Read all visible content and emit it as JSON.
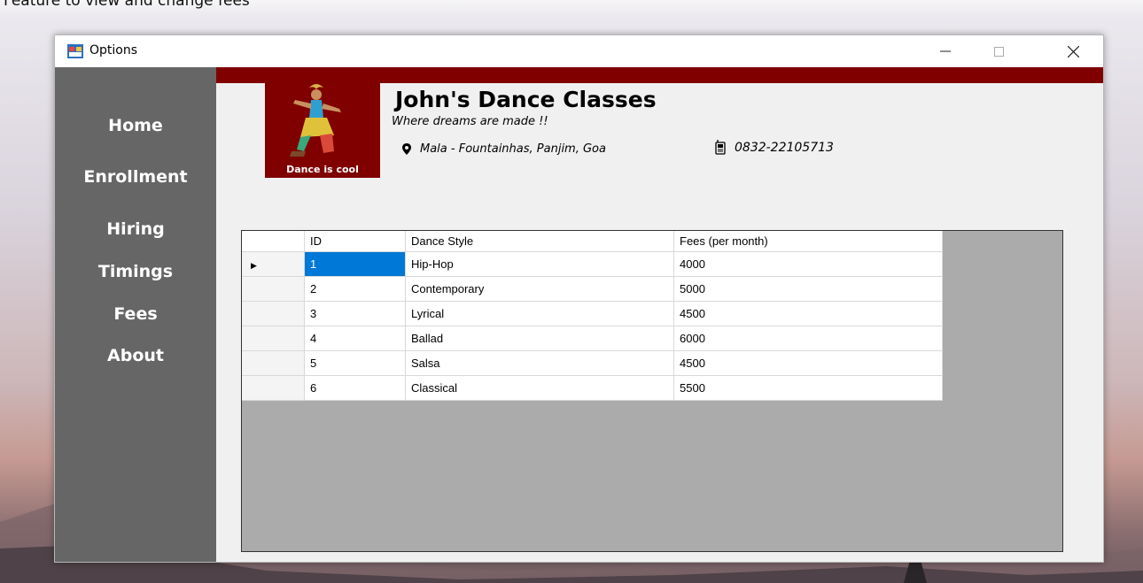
{
  "caption": "Feature to view and change fees",
  "window": {
    "title": "Options",
    "controls": {
      "minimize": "—",
      "maximize": "☐",
      "close": "✕"
    }
  },
  "sidebar": {
    "items": [
      {
        "label": "Home"
      },
      {
        "label": "Enrollment"
      },
      {
        "label": "Hiring"
      },
      {
        "label": "Timings"
      },
      {
        "label": "Fees"
      },
      {
        "label": "About"
      }
    ]
  },
  "header": {
    "logo_caption": "Dance is cool",
    "title": "John's Dance Classes",
    "tagline": "Where dreams are made !!",
    "address": "Mala - Fountainhas, Panjim, Goa",
    "phone": "0832-22105713",
    "address_icon": "location-pin-icon",
    "phone_icon": "phone-icon"
  },
  "colors": {
    "sidebar": "#666666",
    "brand_red": "#800000",
    "selection": "#0078d7",
    "grid_background": "#ababab"
  },
  "fees_table": {
    "columns": [
      "ID",
      "Dance Style",
      "Fees (per month)"
    ],
    "rows": [
      {
        "id": "1",
        "style": "Hip-Hop",
        "fees": "4000"
      },
      {
        "id": "2",
        "style": "Contemporary",
        "fees": "5000"
      },
      {
        "id": "3",
        "style": "Lyrical",
        "fees": "4500"
      },
      {
        "id": "4",
        "style": "Ballad",
        "fees": "6000"
      },
      {
        "id": "5",
        "style": "Salsa",
        "fees": "4500"
      },
      {
        "id": "6",
        "style": "Classical",
        "fees": "5500"
      }
    ],
    "current_row_marker": "▶"
  }
}
